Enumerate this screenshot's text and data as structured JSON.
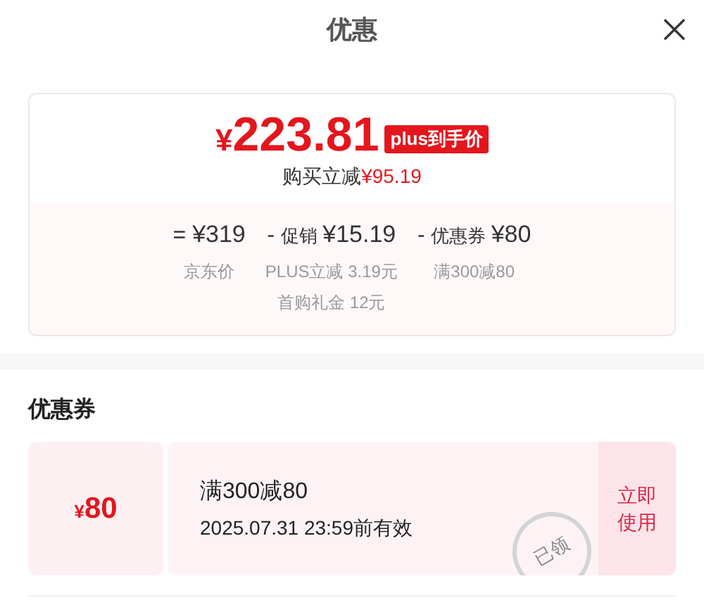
{
  "header": {
    "title": "优惠"
  },
  "price_card": {
    "currency": "¥",
    "price": "223.81",
    "badge": "plus到手价",
    "saving_label": "购买立减",
    "saving": "¥95.19",
    "breakdown": [
      {
        "op": "=",
        "amount": "¥319",
        "notes": [
          "京东价"
        ]
      },
      {
        "op": "-",
        "amount": "¥15.19",
        "label": "促销",
        "notes": [
          "PLUS立减 3.19元",
          "首购礼金 12元"
        ]
      },
      {
        "op": "-",
        "amount": "¥80",
        "label": "优惠券",
        "notes": [
          "满300减80"
        ]
      }
    ]
  },
  "coupons_section": {
    "title": "优惠券",
    "coupons": [
      {
        "currency": "¥",
        "amount": "80",
        "condition": "满300减80",
        "validity": "2025.07.31 23:59前有效",
        "stamp": "已领",
        "claimed": true,
        "action": "立即使用"
      }
    ]
  }
}
